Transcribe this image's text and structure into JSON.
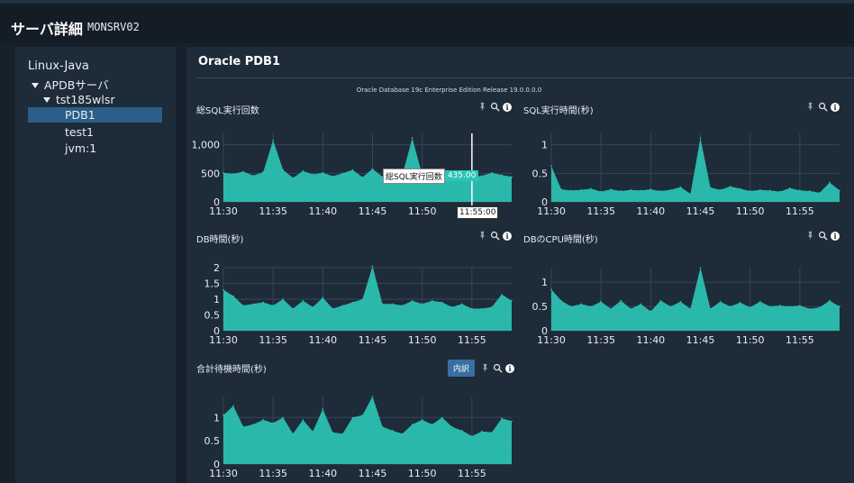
{
  "header": {
    "title": "サーバ詳細",
    "server": "MONSRV02"
  },
  "tree": {
    "root": "Linux-Java",
    "group": "APDBサーバ",
    "host": "tst185wlsr",
    "items": [
      "PDB1",
      "test1",
      "jvm:1"
    ]
  },
  "main": {
    "title": "Oracle PDB1",
    "release": "Oracle Database 19c Enterprise Edition Release 19.0.0.0.0"
  },
  "icons": {
    "pin": "pin-icon",
    "zoom": "zoom-icon",
    "info": "info-icon",
    "expand": "chevron-down-icon"
  },
  "colors": {
    "series": "#2bc4b5",
    "grid": "#35465a",
    "background": "#1e2b38"
  },
  "charts": [
    {
      "title": "総SQL実行回数",
      "info_glyph": "i",
      "tooltip": {
        "label": "総SQL実行回数",
        "value": "435.00",
        "time": "11:55:00"
      },
      "chart_data": {
        "type": "area",
        "x": [
          "11:30",
          "11:31",
          "11:32",
          "11:33",
          "11:34",
          "11:35",
          "11:36",
          "11:37",
          "11:38",
          "11:39",
          "11:40",
          "11:41",
          "11:42",
          "11:43",
          "11:44",
          "11:45",
          "11:46",
          "11:47",
          "11:48",
          "11:49",
          "11:50",
          "11:51",
          "11:52",
          "11:53",
          "11:54",
          "11:55",
          "11:56",
          "11:57",
          "11:58",
          "11:59"
        ],
        "x_ticks": [
          "11:30",
          "11:35",
          "11:40",
          "11:45",
          "11:50"
        ],
        "y_ticks": [
          "0",
          "500",
          "1,000"
        ],
        "ylim": [
          0,
          1200
        ],
        "y_tick_values": [
          0,
          500,
          1000
        ],
        "values": [
          510,
          490,
          530,
          460,
          520,
          1080,
          560,
          420,
          540,
          480,
          510,
          450,
          500,
          560,
          430,
          580,
          440,
          480,
          470,
          1120,
          470,
          500,
          450,
          470,
          445,
          435,
          455,
          510,
          470,
          440
        ]
      }
    },
    {
      "title": "SQL実行時間(秒)",
      "info_glyph": "i",
      "chart_data": {
        "type": "area",
        "x": [
          "11:30",
          "11:31",
          "11:32",
          "11:33",
          "11:34",
          "11:35",
          "11:36",
          "11:37",
          "11:38",
          "11:39",
          "11:40",
          "11:41",
          "11:42",
          "11:43",
          "11:44",
          "11:45",
          "11:46",
          "11:47",
          "11:48",
          "11:49",
          "11:50",
          "11:51",
          "11:52",
          "11:53",
          "11:54",
          "11:55",
          "11:56",
          "11:57",
          "11:58",
          "11:59"
        ],
        "x_ticks": [
          "11:30",
          "11:35",
          "11:40",
          "11:45",
          "11:50",
          "11:55"
        ],
        "y_ticks": [
          "0",
          "0.5",
          "1"
        ],
        "ylim": [
          0,
          1.2
        ],
        "y_tick_values": [
          0,
          0.5,
          1
        ],
        "values": [
          0.63,
          0.22,
          0.2,
          0.21,
          0.23,
          0.18,
          0.22,
          0.19,
          0.21,
          0.2,
          0.22,
          0.19,
          0.21,
          0.26,
          0.14,
          1.12,
          0.25,
          0.21,
          0.27,
          0.23,
          0.19,
          0.21,
          0.2,
          0.18,
          0.24,
          0.2,
          0.19,
          0.16,
          0.34,
          0.2
        ]
      }
    },
    {
      "title": "DB時間(秒)",
      "info_glyph": "i",
      "chart_data": {
        "type": "area",
        "x": [
          "11:30",
          "11:31",
          "11:32",
          "11:33",
          "11:34",
          "11:35",
          "11:36",
          "11:37",
          "11:38",
          "11:39",
          "11:40",
          "11:41",
          "11:42",
          "11:43",
          "11:44",
          "11:45",
          "11:46",
          "11:47",
          "11:48",
          "11:49",
          "11:50",
          "11:51",
          "11:52",
          "11:53",
          "11:54",
          "11:55",
          "11:56",
          "11:57",
          "11:58",
          "11:59"
        ],
        "x_ticks": [
          "11:30",
          "11:35",
          "11:40",
          "11:45",
          "11:50",
          "11:55"
        ],
        "y_ticks": [
          "0",
          "0.5",
          "1",
          "1.5",
          "2"
        ],
        "ylim": [
          0,
          2
        ],
        "y_tick_values": [
          0,
          0.5,
          1,
          1.5,
          2
        ],
        "values": [
          1.3,
          1.1,
          0.8,
          0.85,
          0.9,
          0.8,
          1.0,
          0.7,
          0.95,
          0.75,
          1.05,
          0.7,
          0.8,
          0.9,
          1.0,
          2.05,
          0.85,
          0.85,
          0.8,
          0.95,
          0.85,
          0.95,
          0.9,
          0.75,
          0.85,
          0.7,
          0.7,
          0.75,
          1.15,
          0.95
        ]
      }
    },
    {
      "title": "DBのCPU時間(秒)",
      "info_glyph": "i",
      "chart_data": {
        "type": "area",
        "x": [
          "11:30",
          "11:31",
          "11:32",
          "11:33",
          "11:34",
          "11:35",
          "11:36",
          "11:37",
          "11:38",
          "11:39",
          "11:40",
          "11:41",
          "11:42",
          "11:43",
          "11:44",
          "11:45",
          "11:46",
          "11:47",
          "11:48",
          "11:49",
          "11:50",
          "11:51",
          "11:52",
          "11:53",
          "11:54",
          "11:55",
          "11:56",
          "11:57",
          "11:58",
          "11:59"
        ],
        "x_ticks": [
          "11:30",
          "11:35",
          "11:40",
          "11:45",
          "11:50",
          "11:55"
        ],
        "y_ticks": [
          "0",
          "0.5",
          "1"
        ],
        "ylim": [
          0,
          1.3
        ],
        "y_tick_values": [
          0,
          0.5,
          1
        ],
        "values": [
          0.85,
          0.62,
          0.5,
          0.55,
          0.5,
          0.6,
          0.45,
          0.62,
          0.45,
          0.55,
          0.4,
          0.62,
          0.5,
          0.6,
          0.45,
          1.3,
          0.45,
          0.6,
          0.5,
          0.58,
          0.48,
          0.6,
          0.5,
          0.52,
          0.5,
          0.52,
          0.45,
          0.48,
          0.62,
          0.5
        ]
      }
    },
    {
      "title": "合計待機時間(秒)",
      "info_glyph": "i",
      "breakdown_label": "内訳",
      "chart_data": {
        "type": "area",
        "x": [
          "11:30",
          "11:31",
          "11:32",
          "11:33",
          "11:34",
          "11:35",
          "11:36",
          "11:37",
          "11:38",
          "11:39",
          "11:40",
          "11:41",
          "11:42",
          "11:43",
          "11:44",
          "11:45",
          "11:46",
          "11:47",
          "11:48",
          "11:49",
          "11:50",
          "11:51",
          "11:52",
          "11:53",
          "11:54",
          "11:55",
          "11:56",
          "11:57",
          "11:58",
          "11:59"
        ],
        "x_ticks": [
          "11:30",
          "11:35",
          "11:40",
          "11:45",
          "11:50",
          "11:55"
        ],
        "y_ticks": [
          "0",
          "0.5",
          "1"
        ],
        "ylim": [
          0,
          1.45
        ],
        "y_tick_values": [
          0,
          0.5,
          1
        ],
        "values": [
          1.05,
          1.25,
          0.8,
          0.85,
          0.95,
          0.88,
          1.0,
          0.65,
          0.95,
          0.7,
          1.18,
          0.68,
          0.65,
          1.0,
          1.05,
          1.45,
          0.8,
          0.72,
          0.65,
          0.85,
          0.95,
          0.85,
          1.0,
          0.8,
          0.72,
          0.6,
          0.7,
          0.68,
          0.98,
          0.92
        ]
      }
    }
  ]
}
